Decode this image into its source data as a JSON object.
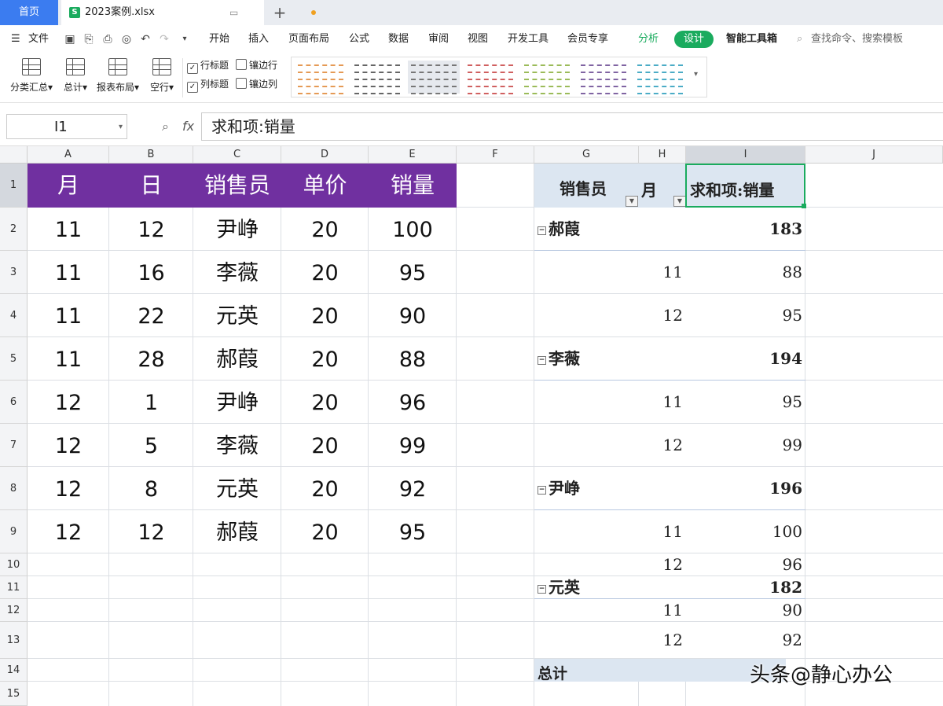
{
  "tabs": {
    "home": "首页",
    "file": "2023案例.xlsx"
  },
  "menu": {
    "file": "文件",
    "items": [
      "开始",
      "插入",
      "页面布局",
      "公式",
      "数据",
      "审阅",
      "视图",
      "开发工具",
      "会员专享"
    ],
    "analyze": "分析",
    "design": "设计",
    "smart_tools": "智能工具箱",
    "search_placeholder": "查找命令、搜索模板"
  },
  "ribbon": {
    "buttons": [
      "分类汇总",
      "总计",
      "报表布局",
      "空行"
    ],
    "checks": [
      {
        "label": "行标题",
        "checked": true
      },
      {
        "label": "镶边行",
        "checked": false
      },
      {
        "label": "列标题",
        "checked": true
      },
      {
        "label": "镶边列",
        "checked": false
      }
    ]
  },
  "formula_bar": {
    "cell_ref": "I1",
    "fx": "fx",
    "formula": "求和项:销量"
  },
  "columns": [
    "A",
    "B",
    "C",
    "D",
    "E",
    "F",
    "G",
    "H",
    "I",
    "J"
  ],
  "rows": [
    "1",
    "2",
    "3",
    "4",
    "5",
    "6",
    "7",
    "8",
    "9",
    "10",
    "11",
    "12",
    "13",
    "14",
    "15"
  ],
  "source_table": {
    "headers": [
      "月",
      "日",
      "销售员",
      "单价",
      "销量"
    ],
    "rows": [
      [
        "11",
        "12",
        "尹峥",
        "20",
        "100"
      ],
      [
        "11",
        "16",
        "李薇",
        "20",
        "95"
      ],
      [
        "11",
        "22",
        "元英",
        "20",
        "90"
      ],
      [
        "11",
        "28",
        "郝葭",
        "20",
        "88"
      ],
      [
        "12",
        "1",
        "尹峥",
        "20",
        "96"
      ],
      [
        "12",
        "5",
        "李薇",
        "20",
        "99"
      ],
      [
        "12",
        "8",
        "元英",
        "20",
        "92"
      ],
      [
        "12",
        "12",
        "郝葭",
        "20",
        "95"
      ]
    ],
    "header_color": "#7030a0"
  },
  "pivot": {
    "headers": {
      "salesperson": "销售员",
      "month": "月",
      "value": "求和项:销量"
    },
    "groups": [
      {
        "name": "郝葭",
        "total": "183",
        "items": [
          {
            "month": "11",
            "value": "88"
          },
          {
            "month": "12",
            "value": "95"
          }
        ]
      },
      {
        "name": "李薇",
        "total": "194",
        "items": [
          {
            "month": "11",
            "value": "95"
          },
          {
            "month": "12",
            "value": "99"
          }
        ]
      },
      {
        "name": "尹峥",
        "total": "196",
        "items": [
          {
            "month": "11",
            "value": "100"
          },
          {
            "month": "12",
            "value": "96"
          }
        ]
      },
      {
        "name": "元英",
        "total": "182",
        "items": [
          {
            "month": "11",
            "value": "90"
          },
          {
            "month": "12",
            "value": "92"
          }
        ]
      }
    ],
    "grand_total_label": "总计"
  },
  "watermark": "头条@静心办公"
}
